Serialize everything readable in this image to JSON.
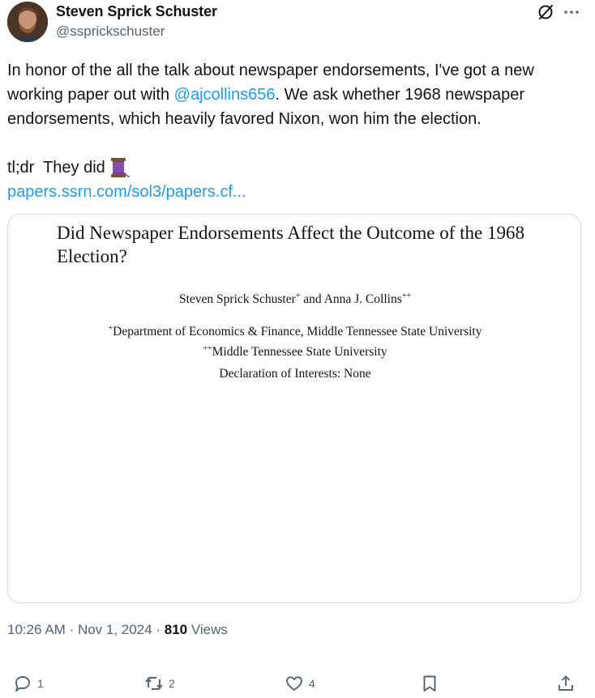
{
  "author": {
    "name": "Steven Sprick Schuster",
    "handle": "@ssprickschuster"
  },
  "tweet": {
    "text_part1": "In honor of the all the talk about newspaper endorsements, I've got a new working paper out with ",
    "mention": "@ajcollins656",
    "text_part2": ". We ask whether 1968 newspaper endorsements, which heavily favored Nixon, won him the election.",
    "tldr": "tl;dr  They did",
    "link": "papers.ssrn.com/sol3/papers.cf..."
  },
  "paper": {
    "title": "Did Newspaper Endorsements Affect the Outcome of the 1968 Election?",
    "authors_a": "Steven Sprick Schuster",
    "authors_a_sup": "+",
    "authors_and": " and ",
    "authors_b": "Anna J. Collins",
    "authors_b_sup": "++",
    "aff1_sup": "+",
    "aff1": "Department of Economics & Finance, Middle Tennessee State University",
    "aff2_sup": "++",
    "aff2": "Middle Tennessee State University",
    "declaration": "Declaration of Interests: None"
  },
  "meta": {
    "time": "10:26 AM",
    "sep1": " · ",
    "date": "Nov 1, 2024",
    "sep2": " · ",
    "views_count": "810",
    "views_label": " Views"
  },
  "actions": {
    "replies": "1",
    "reposts": "2",
    "likes": "4"
  },
  "icons": [
    "grok-icon",
    "more-icon",
    "thread-spool-emoji",
    "reply-icon",
    "repost-icon",
    "like-icon",
    "bookmark-icon",
    "share-icon"
  ],
  "colors": {
    "link": "#1d9bf0",
    "secondary": "#536471",
    "text": "#0f1419",
    "border": "#cfd9de"
  }
}
